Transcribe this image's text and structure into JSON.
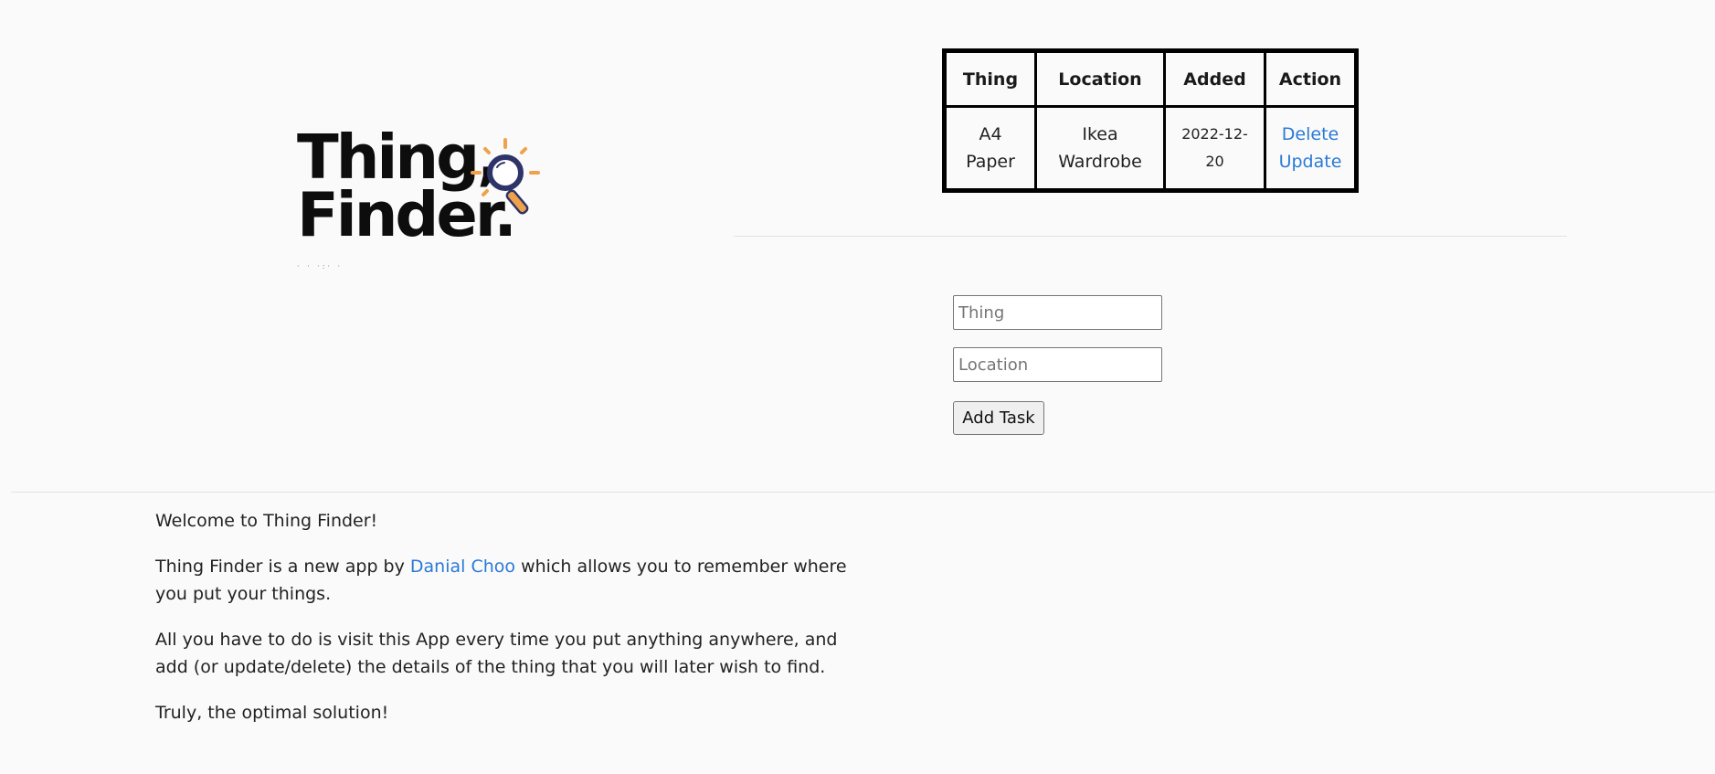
{
  "logo": {
    "line1": "Thing,",
    "line2": "Finder.",
    "tagline": "· · ·:· ·",
    "icon": "magnifying-glass-icon",
    "colors": {
      "text": "#0d0d0d",
      "lens": "#2e3468",
      "handle": "#f0a24a",
      "rays": "#f0a24a"
    }
  },
  "table": {
    "headers": {
      "thing": "Thing",
      "location": "Location",
      "added": "Added",
      "action": "Action"
    },
    "rows": [
      {
        "thing": "A4 Paper",
        "location": "Ikea Wardrobe",
        "added": "2022-12-20",
        "delete_label": "Delete",
        "update_label": "Update"
      }
    ]
  },
  "form": {
    "thing_placeholder": "Thing",
    "thing_value": "",
    "location_placeholder": "Location",
    "location_value": "",
    "submit_label": "Add Task"
  },
  "intro": {
    "welcome": "Welcome to Thing Finder!",
    "p2_before": "Thing Finder is a new app by ",
    "author": "Danial Choo",
    "p2_after": " which allows you to remember where you put your things.",
    "p3": "All you have to do is visit this App every time you put anything anywhere, and add (or update/delete) the details of the thing that you will later wish to find.",
    "closing": "Truly, the optimal solution!"
  },
  "colors": {
    "link": "#2a7ad6",
    "background": "#fafafa",
    "divider": "#e3e3e3"
  }
}
